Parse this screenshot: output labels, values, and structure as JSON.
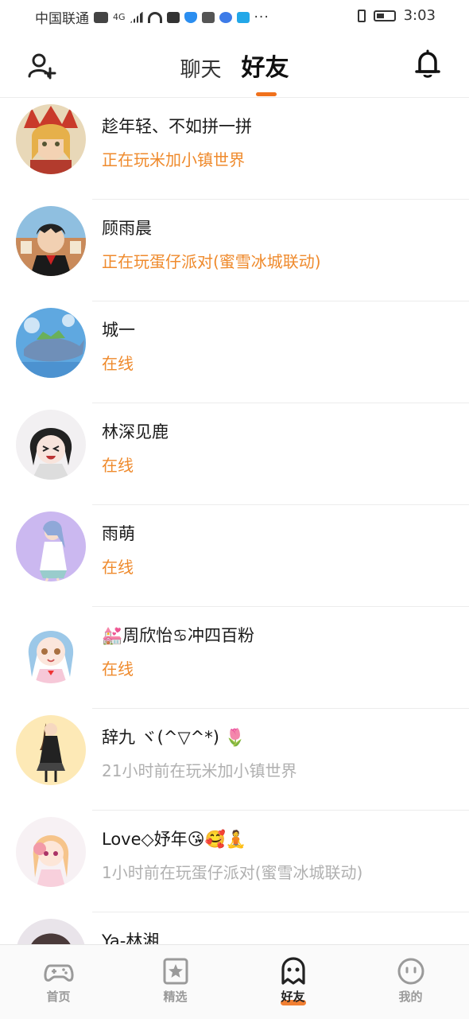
{
  "status_bar": {
    "carrier": "中国联通",
    "network": "4G",
    "time": "3:03"
  },
  "header": {
    "tabs": [
      {
        "label": "聊天",
        "active": false
      },
      {
        "label": "好友",
        "active": true
      }
    ],
    "accent_color": "#f0711c"
  },
  "friends": [
    {
      "name": "趁年轻、不如拼一拼",
      "status": "正在玩米加小镇世界",
      "status_type": "playing"
    },
    {
      "name": "顾雨晨",
      "status": "正在玩蛋仔派对(蜜雪冰城联动)",
      "status_type": "playing"
    },
    {
      "name": "城一",
      "status": "在线",
      "status_type": "online"
    },
    {
      "name": "林深见鹿",
      "status": "在线",
      "status_type": "online"
    },
    {
      "name": "雨萌",
      "status": "在线",
      "status_type": "online"
    },
    {
      "name": "💒周欣怡♋冲四百粉",
      "status": "在线",
      "status_type": "online"
    },
    {
      "name": "辞九 ヾ(^▽^*) 🌷",
      "status": "21小时前在玩米加小镇世界",
      "status_type": "offline"
    },
    {
      "name": "Love◇妤年😘🥰🧘",
      "status": "1小时前在玩蛋仔派对(蜜雪冰城联动)",
      "status_type": "offline"
    },
    {
      "name": "Ya-林湘.",
      "status": "",
      "status_type": "offline"
    }
  ],
  "bottom_nav": [
    {
      "label": "首页",
      "icon": "gamepad-icon",
      "active": false
    },
    {
      "label": "精选",
      "icon": "star-card-icon",
      "active": false
    },
    {
      "label": "好友",
      "icon": "ghost-icon",
      "active": true
    },
    {
      "label": "我的",
      "icon": "face-icon",
      "active": false
    }
  ],
  "colors": {
    "status_playing": "#ef8a2c",
    "status_offline": "#b0b0b0"
  }
}
